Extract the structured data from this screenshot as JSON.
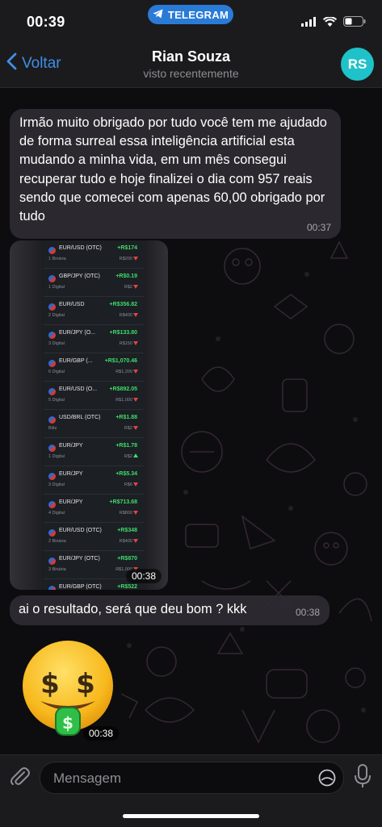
{
  "status_bar": {
    "time": "00:39",
    "app_pill": "TELEGRAM",
    "icons": [
      "telegram-icon",
      "signal-icon",
      "wifi-icon",
      "battery-icon"
    ]
  },
  "header": {
    "back_label": "Voltar",
    "contact_name": "Rian Souza",
    "status": "visto recentemente",
    "avatar_initials": "RS",
    "avatar_color": "#1fc2c8"
  },
  "messages": [
    {
      "type": "text",
      "text": "Irmão muito obrigado por tudo você tem me ajudado de forma surreal essa inteligência artificial esta mudando a minha vida, em um mês consegui recuperar tudo e hoje finalizei o dia com 957 reais sendo que comecei com apenas 60,00 obrigado por tudo",
      "time": "00:37"
    },
    {
      "type": "photo",
      "time": "00:38",
      "trades": [
        {
          "pair": "EUR/USD (OTC)",
          "sub": "1 Binária",
          "profit": "+R$174",
          "amount": "R$200",
          "dir": "down"
        },
        {
          "pair": "GBP/JPY (OTC)",
          "sub": "1 Digital",
          "profit": "+R$0.19",
          "amount": "R$2",
          "dir": "down"
        },
        {
          "pair": "EUR/USD",
          "sub": "2 Digital",
          "profit": "+R$356.82",
          "amount": "R$400",
          "dir": "down"
        },
        {
          "pair": "EUR/JPY (O...",
          "sub": "3 Digital",
          "profit": "+R$133.80",
          "amount": "R$150",
          "dir": "down"
        },
        {
          "pair": "EUR/GBP (...",
          "sub": "6 Digital",
          "profit": "+R$1,070.46",
          "amount": "R$1,200",
          "dir": "down"
        },
        {
          "pair": "EUR/USD (O...",
          "sub": "5 Digital",
          "profit": "+R$892.05",
          "amount": "R$1,000",
          "dir": "down"
        },
        {
          "pair": "USD/BRL (OTC)",
          "sub": "Blitz",
          "profit": "+R$1.88",
          "amount": "R$2",
          "dir": "down"
        },
        {
          "pair": "EUR/JPY",
          "sub": "1 Digital",
          "profit": "+R$1.78",
          "amount": "R$2",
          "dir": "up"
        },
        {
          "pair": "EUR/JPY",
          "sub": "3 Digital",
          "profit": "+R$5.34",
          "amount": "R$6",
          "dir": "down"
        },
        {
          "pair": "EUR/JPY",
          "sub": "4 Digital",
          "profit": "+R$713.68",
          "amount": "R$800",
          "dir": "down"
        },
        {
          "pair": "EUR/USD (OTC)",
          "sub": "2 Binária",
          "profit": "+R$348",
          "amount": "R$400",
          "dir": "down"
        },
        {
          "pair": "EUR/JPY (OTC)",
          "sub": "3 Binária",
          "profit": "+R$870",
          "amount": "R$1,000",
          "dir": "down"
        },
        {
          "pair": "EUR/GBP (OTC)",
          "sub": "3 Binária",
          "profit": "+R$522",
          "amount": "R$600",
          "dir": "down"
        }
      ]
    },
    {
      "type": "text",
      "text": "ai o resultado, será que deu bom ? kkk",
      "time": "00:38"
    },
    {
      "type": "sticker",
      "sticker": "money-mouth-face-icon",
      "time": "00:38"
    }
  ],
  "input_bar": {
    "placeholder": "Mensagem",
    "icons": [
      "paperclip-icon",
      "sticker-icon",
      "microphone-icon"
    ]
  },
  "colors": {
    "accent": "#3f8fe6",
    "bubble": "#2e2c32",
    "profit": "#3fdc6a",
    "loss_arrow": "#e04545"
  }
}
